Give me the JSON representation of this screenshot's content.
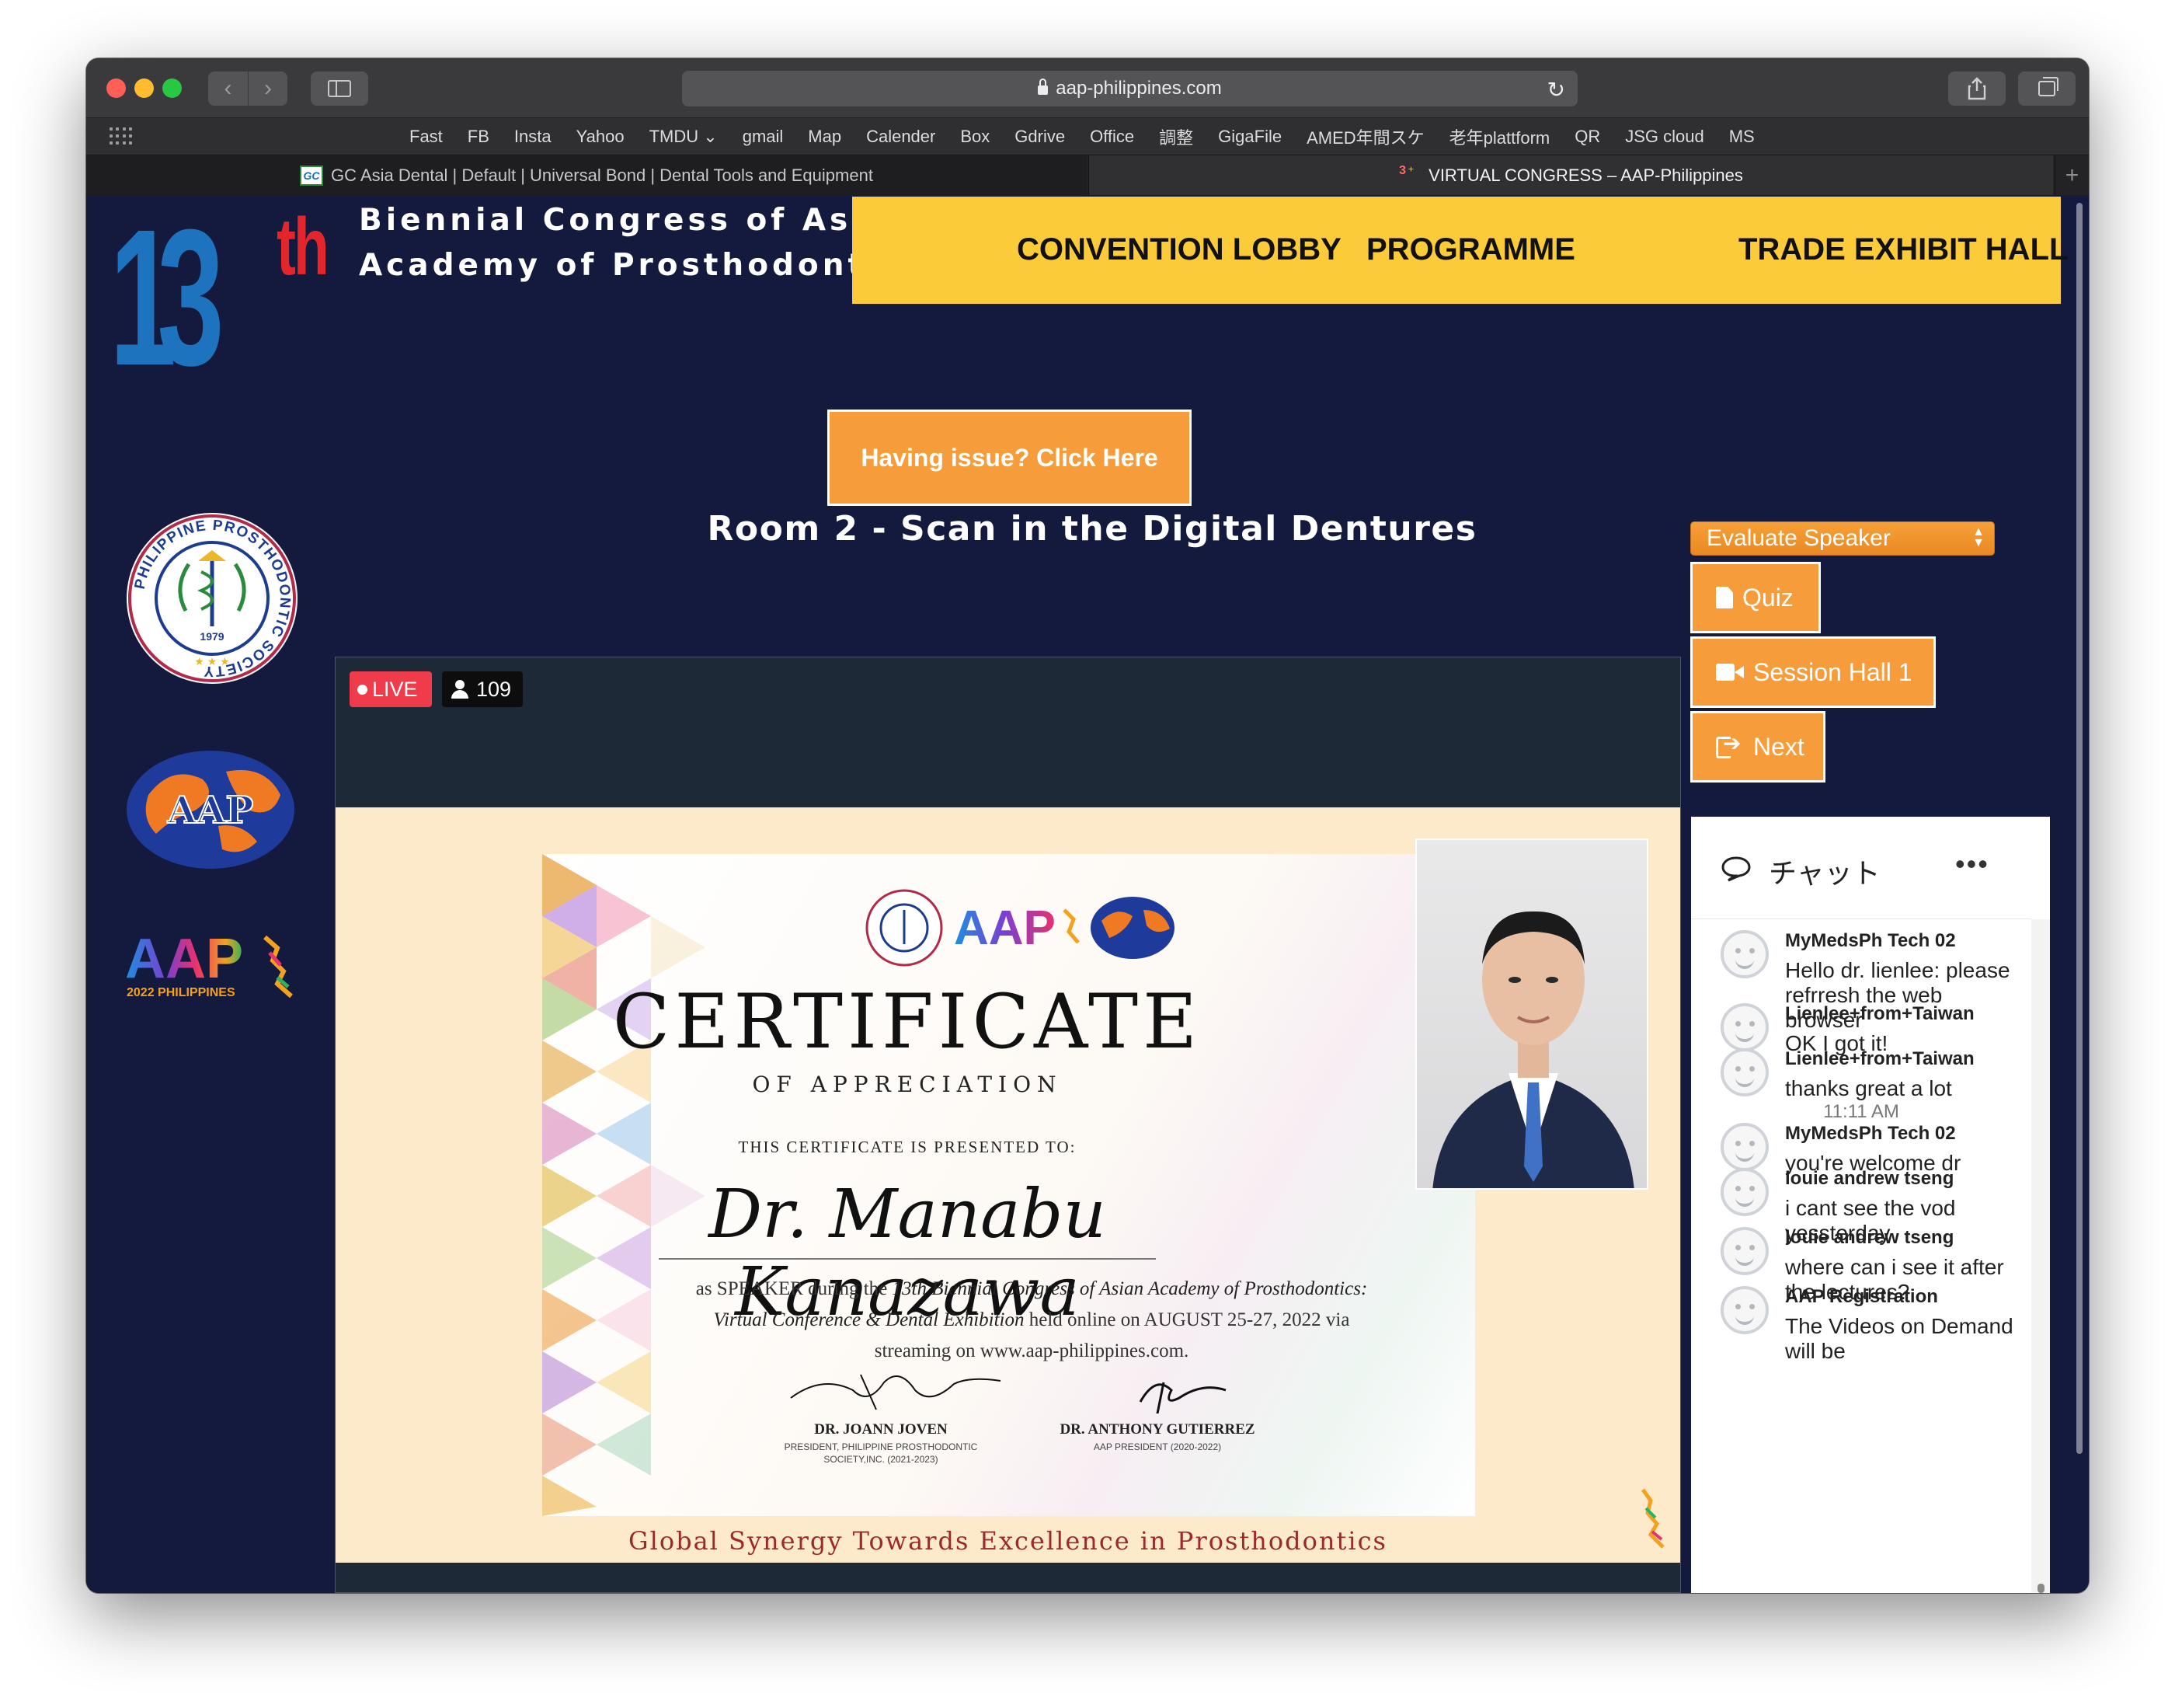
{
  "browser": {
    "url": "aap-philippines.com",
    "bookmarks": [
      "Fast",
      "FB",
      "Insta",
      "Yahoo",
      "TMDU ⌄",
      "gmail",
      "Map",
      "Calender",
      "Box",
      "Gdrive",
      "Office",
      "調整",
      "GigaFile",
      "AMED年間スケ",
      "老年plattform",
      "QR",
      "JSG cloud",
      "MS"
    ],
    "tabs": [
      {
        "label": "GC Asia Dental | Default | Universal Bond | Dental Tools and Equipment",
        "icon_text": "GC",
        "active": false
      },
      {
        "label": "VIRTUAL CONGRESS – AAP-Philippines",
        "active": true
      }
    ],
    "new_tab_symbol": "+"
  },
  "header": {
    "number": "13",
    "suffix": "th",
    "title_line1": "Biennial Congress of Asian",
    "title_line2": "Academy of Prosthodontics",
    "nav": [
      "CONVENTION LOBBY",
      "PROGRAMME",
      "TRADE EXHIBIT HALL"
    ]
  },
  "issue_button": "Having issue? Click Here",
  "room_title": "Room 2 - Scan in the Digital Dentures",
  "controls": {
    "evaluate_select": "Evaluate Speaker",
    "quiz": "Quiz",
    "session_hall": "Session Hall 1",
    "next": "Next"
  },
  "logos": {
    "pps_ring_text": "PHILIPPINE PROSTHODONTIC SOCIETY",
    "pps_year": "1979",
    "aap_globe_text": "AAP",
    "aap_word": "AAP",
    "aap_year": "2022 PHILIPPINES"
  },
  "video": {
    "live_label": "LIVE",
    "viewers": "109",
    "certificate": {
      "title": "CERTIFICATE",
      "subtitle": "OF APPRECIATION",
      "presented_to": "THIS CERTIFICATE IS PRESENTED TO:",
      "name": "Dr. Manabu Kanazawa",
      "body_prefix": "as SPEAKER during the ",
      "body_event": "13th Biennial Congress of Asian Academy of Prosthodontics:",
      "body_event2": "Virtual Conference & Dental Exhibition",
      "body_mid": " held online on AUGUST 25-27, 2022 via",
      "body_suffix": "streaming on www.aap-philippines.com.",
      "signer1_name": "DR. JOANN JOVEN",
      "signer1_role_line1": "PRESIDENT, PHILIPPINE PROSTHODONTIC",
      "signer1_role_line2": "SOCIETY,INC. (2021-2023)",
      "signer2_name": "DR. ANTHONY GUTIERREZ",
      "signer2_role": "AAP PRESIDENT (2020-2022)",
      "footer": "Global Synergy Towards Excellence in Prosthodontics"
    }
  },
  "chat": {
    "title": "チャット",
    "more": "•••",
    "messages": [
      {
        "user": "MyMedsPh Tech 02",
        "text": "Hello dr. lienlee: please refrresh the web browser"
      },
      {
        "user": "Lienlee+from+Taiwan",
        "text": "OK I got it!"
      },
      {
        "user": "Lienlee+from+Taiwan",
        "text": "thanks great a lot"
      },
      {
        "time": "11:11 AM"
      },
      {
        "user": "MyMedsPh Tech 02",
        "text": "you're welcome dr"
      },
      {
        "user": "louie andrew tseng",
        "text": "i cant see the vod yessterday"
      },
      {
        "user": "louie andrew tseng",
        "text": "where can i see it after the lectures?"
      },
      {
        "user": "AAP Registration",
        "text": "The Videos on Demand will be"
      }
    ]
  },
  "colors": {
    "page_bg": "#141a3d",
    "nav_yellow": "#fccb3a",
    "button_orange": "#f79c3a",
    "live_red": "#ef3b4a",
    "blue_13": "#1e73be",
    "yellow_13": "#fcd33a",
    "red_th": "#e3262b"
  }
}
